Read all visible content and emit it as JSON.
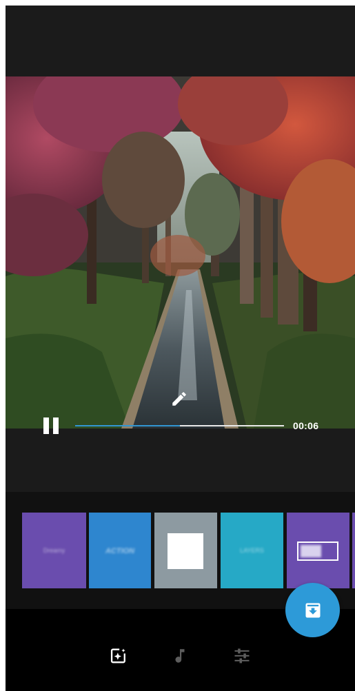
{
  "player": {
    "time_label": "00:06",
    "progress": 0.5,
    "state": "playing",
    "pause_icon": "pause-icon",
    "edit_icon": "pencil-icon"
  },
  "themes": [
    {
      "label": "Dreamy",
      "color": "#6a4dae",
      "selected": true
    },
    {
      "label": "ACTION",
      "color": "#2e86cf",
      "selected": false
    },
    {
      "label": "",
      "color": "#8d9aa1",
      "selected": false
    },
    {
      "label": "LAYERS",
      "color": "#26a9c6",
      "selected": false
    },
    {
      "label": "Retro",
      "color": "#6a4dae",
      "selected": false
    }
  ],
  "bottom_nav": {
    "tabs": [
      {
        "icon": "theme-sparkle-icon",
        "active": true
      },
      {
        "icon": "music-note-icon",
        "active": false
      },
      {
        "icon": "adjust-sliders-icon",
        "active": false
      }
    ]
  },
  "fab": {
    "icon": "save-download-icon",
    "color": "#2d9ad8"
  }
}
